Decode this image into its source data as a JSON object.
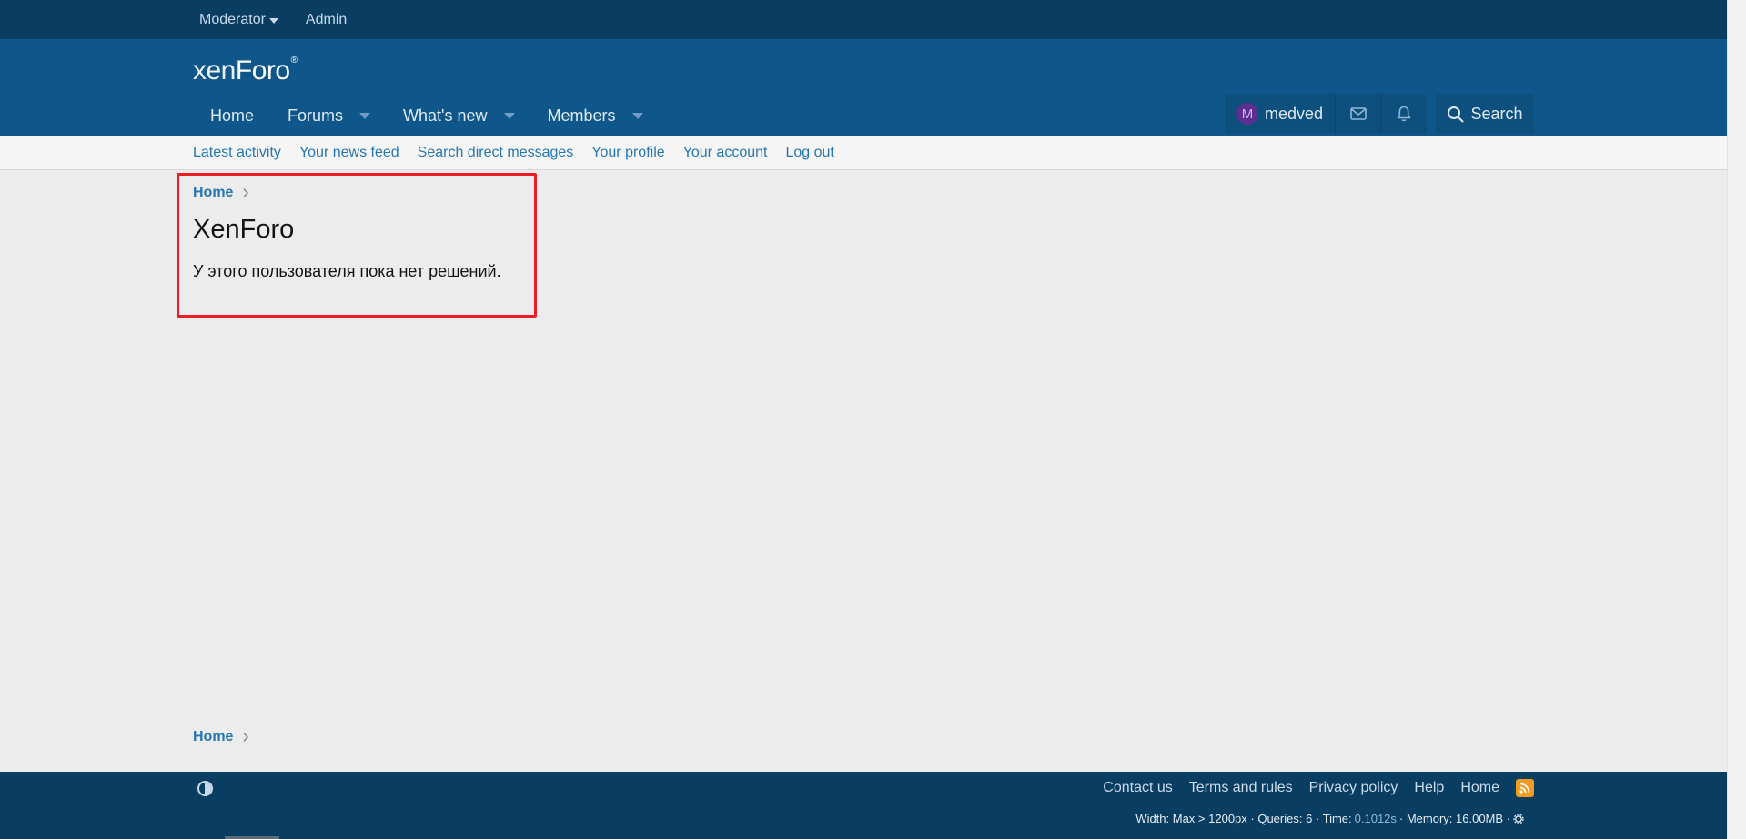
{
  "staff_bar": {
    "moderator_label": "Moderator",
    "admin_label": "Admin"
  },
  "header": {
    "logo_xen": "xen",
    "logo_foro": "Foro",
    "logo_tm": "®",
    "nav_tabs": [
      {
        "label": "Home"
      },
      {
        "label": "Forums"
      },
      {
        "label": "What's new"
      },
      {
        "label": "Members"
      }
    ],
    "visitor": {
      "avatar_letter": "M",
      "username": "medved"
    },
    "search_label": "Search"
  },
  "sub_nav": {
    "links": [
      "Latest activity",
      "Your news feed",
      "Search direct messages",
      "Your profile",
      "Your account",
      "Log out"
    ]
  },
  "breadcrumb": {
    "home_label": "Home"
  },
  "main": {
    "title": "XenForo",
    "message": "У этого пользователя пока нет решений."
  },
  "footer": {
    "links": [
      "Contact us",
      "Terms and rules",
      "Privacy policy",
      "Help",
      "Home"
    ],
    "debug_prefix": "Width: Max > 1200px · Queries: 6 · Time:",
    "debug_time": "0.1012s",
    "debug_suffix": "· Memory: 16.00MB ·"
  },
  "colors": {
    "staff_bar": "#0a3d62",
    "header": "#0f578a",
    "link": "#2577b1",
    "highlight": "#ef1c24",
    "rss": "#f29d1f"
  }
}
